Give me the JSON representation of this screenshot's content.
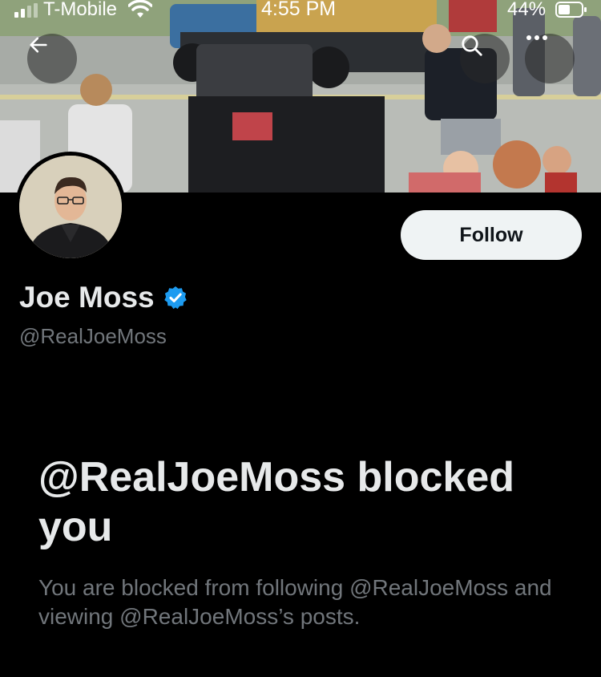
{
  "status_bar": {
    "carrier": "T-Mobile",
    "time": "4:55 PM",
    "battery_percent": "44%",
    "icons": [
      "signal-icon",
      "wifi-icon",
      "battery-icon"
    ]
  },
  "header": {
    "back_icon": "arrow-left-icon",
    "search_icon": "search-icon",
    "more_icon": "more-horizontal-icon"
  },
  "profile": {
    "display_name": "Joe Moss",
    "handle": "@RealJoeMoss",
    "verified": true,
    "verified_color": "#1d9bf0",
    "follow_label": "Follow"
  },
  "blocked_notice": {
    "title": "@RealJoeMoss blocked you",
    "description": "You are blocked from following @RealJoeMoss and viewing @RealJoeMoss’s posts."
  },
  "colors": {
    "background": "#000000",
    "primary_text": "#e7e9ea",
    "secondary_text": "#71767b",
    "follow_button_bg": "#eff3f4"
  }
}
